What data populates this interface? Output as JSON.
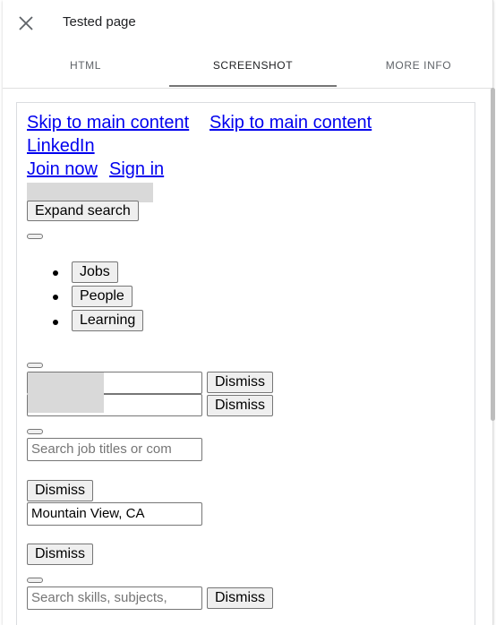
{
  "header": {
    "title": "Tested page"
  },
  "tabs": [
    {
      "label": "HTML",
      "active": false
    },
    {
      "label": "SCREENSHOT",
      "active": true
    },
    {
      "label": "MORE INFO",
      "active": false
    }
  ],
  "page": {
    "links_line1": [
      "Skip to main content",
      "Skip to main content"
    ],
    "link_brand": "LinkedIn",
    "links_line3": [
      "Join now",
      "Sign in"
    ],
    "expand_search": "Expand search",
    "nav_items": [
      "Jobs",
      "People",
      "Learning"
    ],
    "dismiss": "Dismiss",
    "job_search_placeholder": "Search job titles or com",
    "location_value": "Mountain View, CA",
    "skills_placeholder": "Search skills, subjects,"
  },
  "colors": {
    "link": "#0000ee",
    "tab_indicator": "#757575"
  }
}
